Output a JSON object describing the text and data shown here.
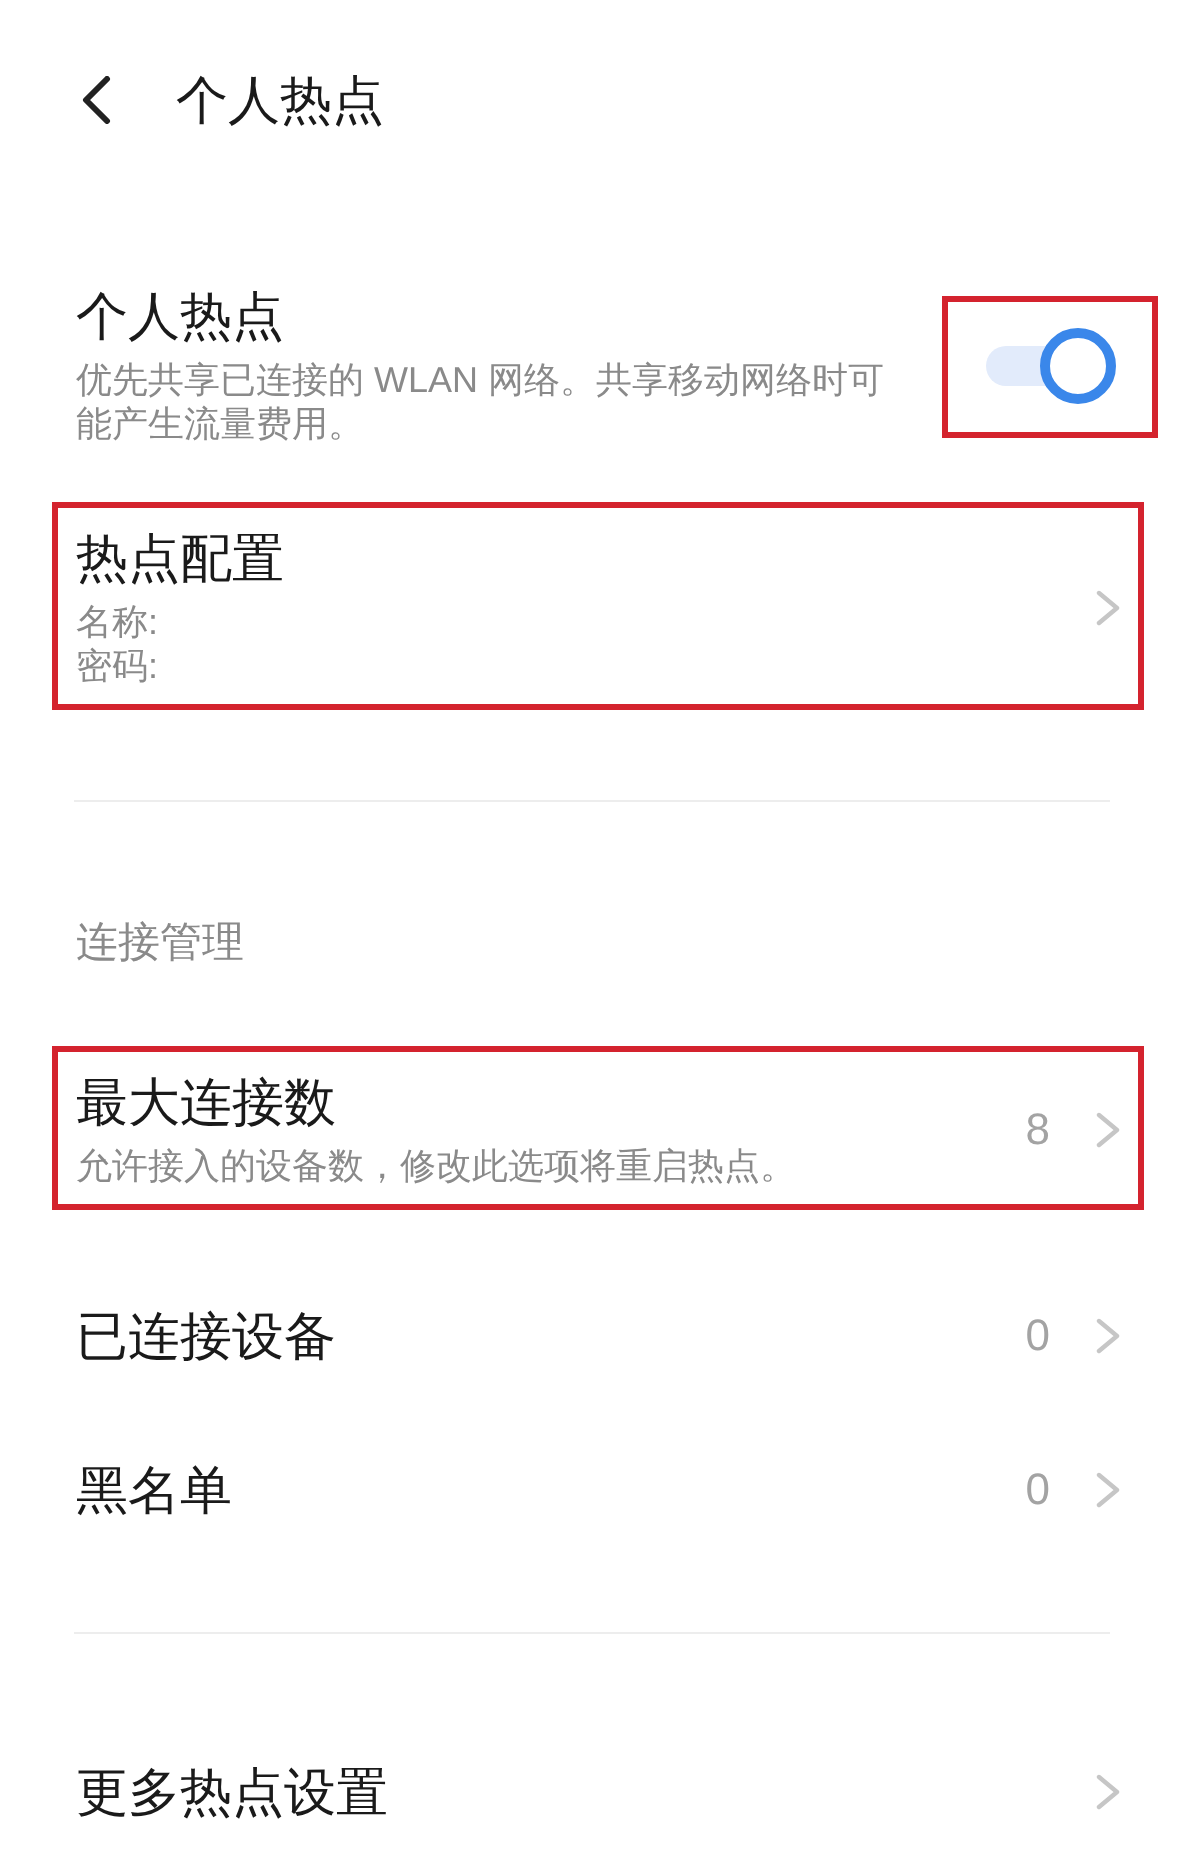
{
  "header": {
    "title": "个人热点"
  },
  "groups": [
    {
      "items": [
        {
          "kind": "toggle",
          "title": "个人热点",
          "summary": "优先共享已连接的 WLAN 网络。共享移动网络时可能产生流量费用。",
          "on": true,
          "highlighted": true
        },
        {
          "kind": "link",
          "title": "热点配置",
          "details": [
            "名称:",
            "密码:"
          ],
          "highlighted": true
        }
      ]
    },
    {
      "header": "连接管理",
      "items": [
        {
          "kind": "link",
          "title": "最大连接数",
          "summary": "允许接入的设备数，修改此选项将重启热点。",
          "value": "8",
          "highlighted": true
        },
        {
          "kind": "link",
          "title": "已连接设备",
          "value": "0",
          "highlighted": false
        },
        {
          "kind": "link",
          "title": "黑名单",
          "value": "0",
          "highlighted": false
        }
      ]
    },
    {
      "items": [
        {
          "kind": "link",
          "title": "更多热点设置",
          "highlighted": false
        }
      ]
    }
  ]
}
